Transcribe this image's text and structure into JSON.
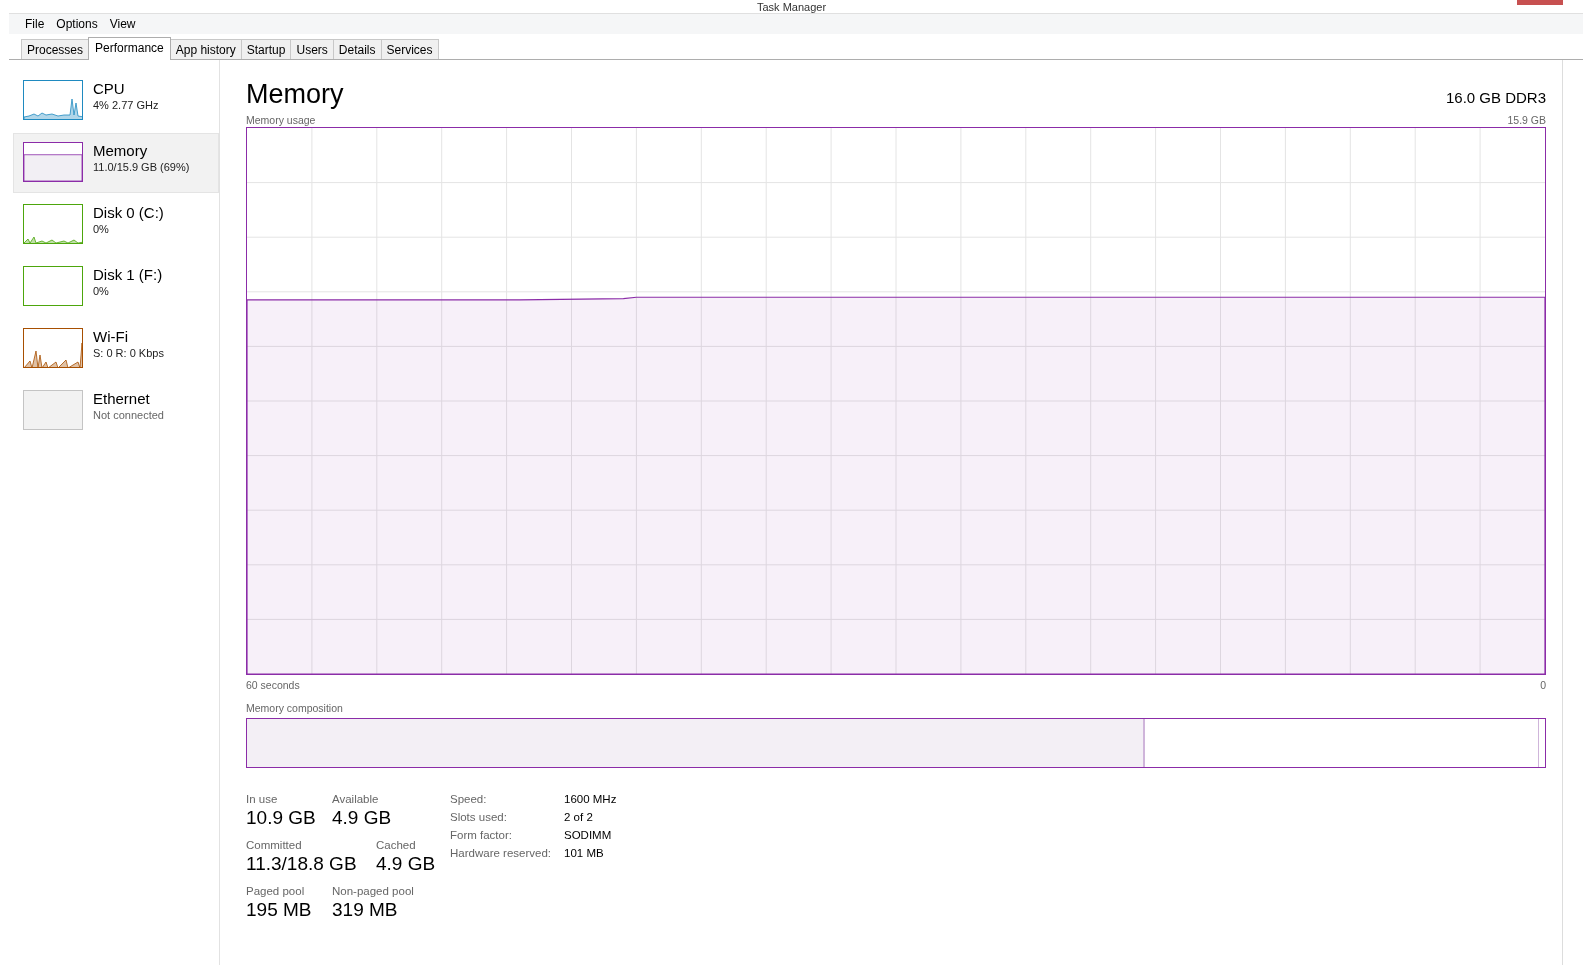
{
  "window": {
    "title": "Task Manager"
  },
  "menu": [
    "File",
    "Options",
    "View"
  ],
  "tabs": [
    {
      "label": "Processes",
      "selected": false
    },
    {
      "label": "Performance",
      "selected": true
    },
    {
      "label": "App history",
      "selected": false
    },
    {
      "label": "Startup",
      "selected": false
    },
    {
      "label": "Users",
      "selected": false
    },
    {
      "label": "Details",
      "selected": false
    },
    {
      "label": "Services",
      "selected": false
    }
  ],
  "sidebar": {
    "items": [
      {
        "kind": "cpu",
        "title": "CPU",
        "subtitle": "4% 2.77 GHz",
        "color": "#1f8ac0",
        "selected": false
      },
      {
        "kind": "memory",
        "title": "Memory",
        "subtitle": "11.0/15.9 GB (69%)",
        "color": "#8b2ca8",
        "selected": true
      },
      {
        "kind": "disk",
        "title": "Disk 0 (C:)",
        "subtitle": "0%",
        "color": "#4da60c",
        "selected": false
      },
      {
        "kind": "idle",
        "title": "Disk 1 (F:)",
        "subtitle": "0%",
        "color": "#4da60c",
        "selected": false
      },
      {
        "kind": "wifi",
        "title": "Wi-Fi",
        "subtitle": "S: 0 R: 0 Kbps",
        "color": "#a74f01",
        "selected": false
      },
      {
        "kind": "off",
        "title": "Ethernet",
        "subtitle": "Not connected",
        "color": "#c4c4c4",
        "selected": false
      }
    ]
  },
  "main": {
    "title": "Memory",
    "hardware": "16.0 GB DDR3",
    "usage_graph": {
      "label": "Memory usage",
      "max": "15.9 GB",
      "x_start": "60 seconds",
      "x_end": "0"
    },
    "composition": {
      "label": "Memory composition",
      "segments": [
        {
          "kind": "in_use",
          "level": 0.69
        }
      ]
    },
    "stats": [
      {
        "label": "In use",
        "value": "10.9 GB"
      },
      {
        "label": "Available",
        "value": "4.9 GB"
      },
      {
        "label": "Committed",
        "value": "11.3/18.8 GB"
      },
      {
        "label": "Cached",
        "value": "4.9 GB"
      },
      {
        "label": "Paged pool",
        "value": "195 MB"
      },
      {
        "label": "Non-paged pool",
        "value": "319 MB"
      }
    ],
    "details": [
      {
        "key": "Speed:",
        "value": "1600 MHz"
      },
      {
        "key": "Slots used:",
        "value": "2 of 2"
      },
      {
        "key": "Form factor:",
        "value": "SODIMM"
      },
      {
        "key": "Hardware reserved:",
        "value": "101 MB"
      }
    ]
  }
}
